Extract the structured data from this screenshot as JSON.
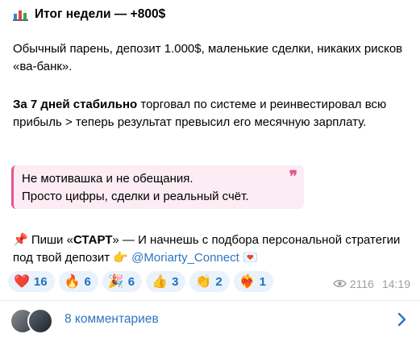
{
  "post": {
    "title": "Итог недели — +800$",
    "p1": "Обычный парень, депозит 1.000$, маленькие сделки, никаких рисков «ва-банк».",
    "p2_bold": "За 7 дней стабильно",
    "p2_rest": " торговал по системе и реинвестировал всю прибыль > теперь результат превысил его месячную зарплату.",
    "quote_line1": "Не мотивашка и не обещания.",
    "quote_line2": "Просто цифры, сделки и реальный счёт.",
    "quote_mark": "❞",
    "cta_pin": "📌",
    "cta_pre": " Пиши «",
    "cta_bold": "СТАРТ",
    "cta_mid": "» — И начнешь с подбора персональной стратегии под твой депозит ",
    "cta_point": "👉",
    "cta_link": "@Moriarty_Connect",
    "cta_envelope": "💌"
  },
  "reactions": [
    {
      "emoji": "❤️",
      "count": "16"
    },
    {
      "emoji": "🔥",
      "count": "6"
    },
    {
      "emoji": "🎉",
      "count": "6"
    },
    {
      "emoji": "👍",
      "count": "3"
    },
    {
      "emoji": "👏",
      "count": "2"
    },
    {
      "emoji": "❤️‍🔥",
      "count": "1"
    }
  ],
  "meta": {
    "views": "2116",
    "time": "14:19"
  },
  "comments": {
    "label": "8 комментариев"
  },
  "colors": {
    "accent": "#2e74c0",
    "quote_bar": "#e3568f",
    "quote_bg": "#fcecf3",
    "reaction_bg": "#eaf2fb"
  }
}
